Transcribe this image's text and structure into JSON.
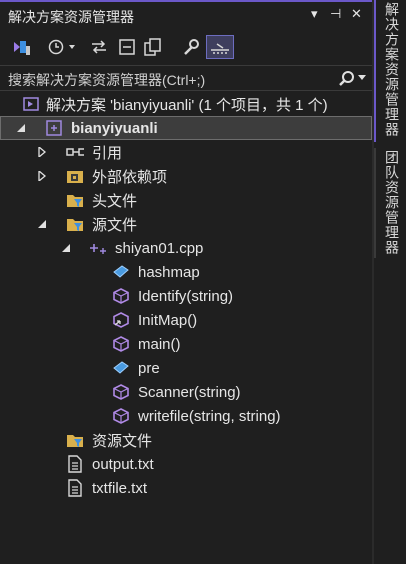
{
  "panel": {
    "title": "解决方案资源管理器",
    "controls": [
      "▾",
      "⊣",
      "✕"
    ]
  },
  "search": {
    "placeholder": "搜索解决方案资源管理器(Ctrl+;)"
  },
  "tree": {
    "solution": "解决方案 'bianyiyuanli' (1 个项目，共 1 个)",
    "project": "bianyiyuanli",
    "references": "引用",
    "external_deps": "外部依赖项",
    "header_files": "头文件",
    "source_files": "源文件",
    "cpp_file": "shiyan01.cpp",
    "members": [
      "hashmap",
      "Identify(string)",
      "InitMap()",
      "main()",
      "pre",
      "Scanner(string)",
      "writefile(string, string)"
    ],
    "resource_files": "资源文件",
    "output_txt": "output.txt",
    "txtfile_txt": "txtfile.txt"
  },
  "side_tabs": {
    "solution_explorer": "解决方案资源管理器",
    "team_explorer": "团队资源管理器"
  },
  "colors": {
    "accent": "#6b58c9",
    "folder": "#d9b04c",
    "member_purple": "#b08ae6",
    "struct_blue": "#4a9be0"
  }
}
